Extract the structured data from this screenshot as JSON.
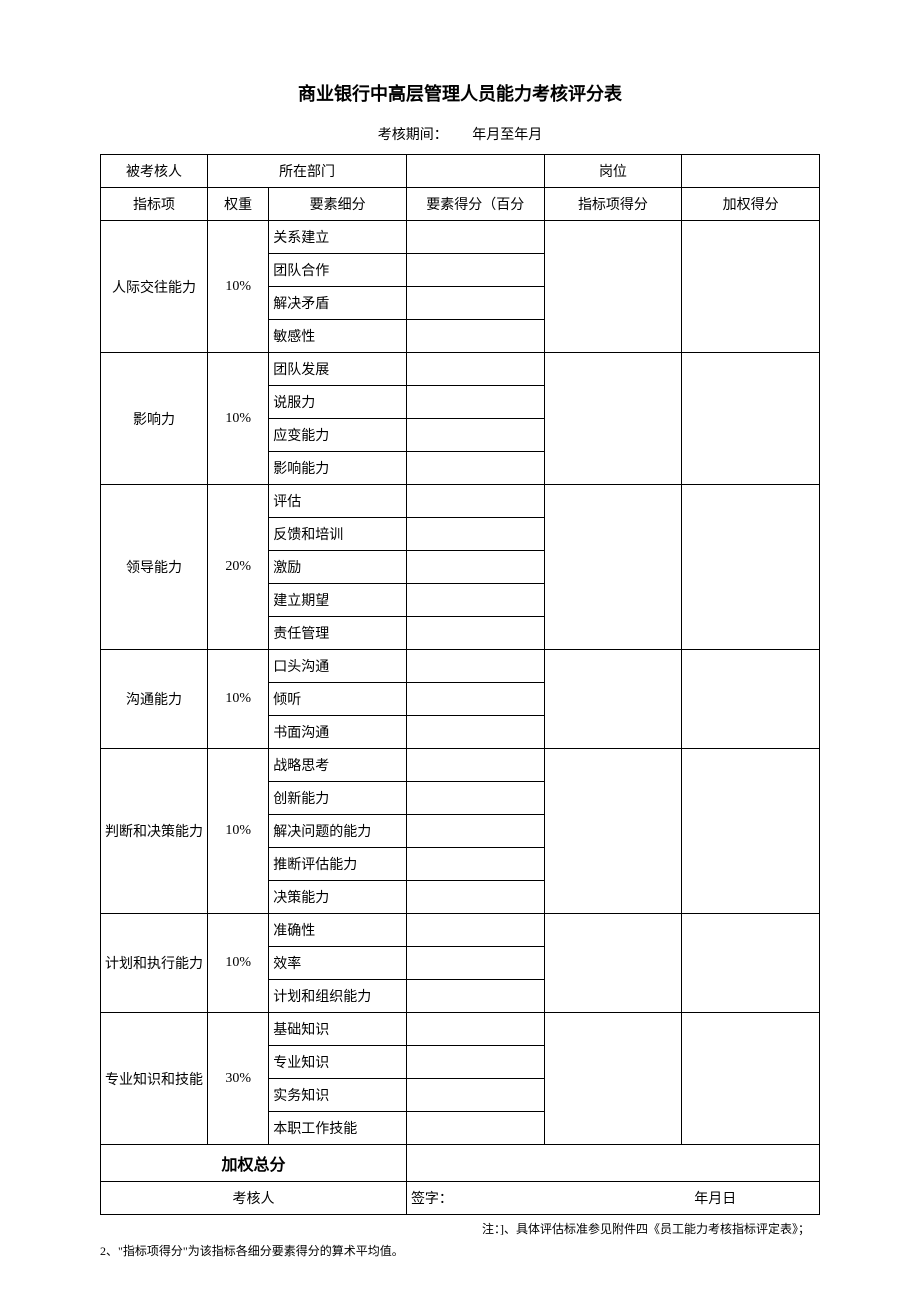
{
  "title": "商业银行中高层管理人员能力考核评分表",
  "period_label": "考核期间：",
  "period_value": "年月至年月",
  "header_row1": {
    "assessee": "被考核人",
    "dept": "所在部门",
    "post": "岗位"
  },
  "header_row2": {
    "indicator": "指标项",
    "weight": "权重",
    "element": "要素细分",
    "element_score": "要素得分（百分",
    "indicator_score": "指标项得分",
    "weighted_score": "加权得分"
  },
  "sections": [
    {
      "name": "人际交往能力",
      "weight": "10%",
      "items": [
        "关系建立",
        "团队合作",
        "解决矛盾",
        "敏感性"
      ]
    },
    {
      "name": "影响力",
      "weight": "10%",
      "items": [
        "团队发展",
        "说服力",
        "应变能力",
        "影响能力"
      ]
    },
    {
      "name": "领导能力",
      "weight": "20%",
      "items": [
        "评估",
        "反馈和培训",
        "激励",
        "建立期望",
        "责任管理"
      ]
    },
    {
      "name": "沟通能力",
      "weight": "10%",
      "items": [
        "口头沟通",
        "倾听",
        "书面沟通"
      ]
    },
    {
      "name": "判断和决策能力",
      "weight": "10%",
      "items": [
        "战略思考",
        "创新能力",
        "解决问题的能力",
        "推断评估能力",
        "决策能力"
      ]
    },
    {
      "name": "计划和执行能力",
      "weight": "10%",
      "items": [
        "准确性",
        "效率",
        "计划和组织能力"
      ]
    },
    {
      "name": "专业知识和技能",
      "weight": "30%",
      "items": [
        "基础知识",
        "专业知识",
        "实务知识",
        "本职工作技能"
      ]
    }
  ],
  "total_label": "加权总分",
  "assessor": "考核人",
  "sign_label": "签字：",
  "date_label": "年月日",
  "note1": "注：]、具体评估标准参见附件四《员工能力考核指标评定表》；",
  "note2": "2、\"指标项得分\"为该指标各细分要素得分的算术平均值。"
}
